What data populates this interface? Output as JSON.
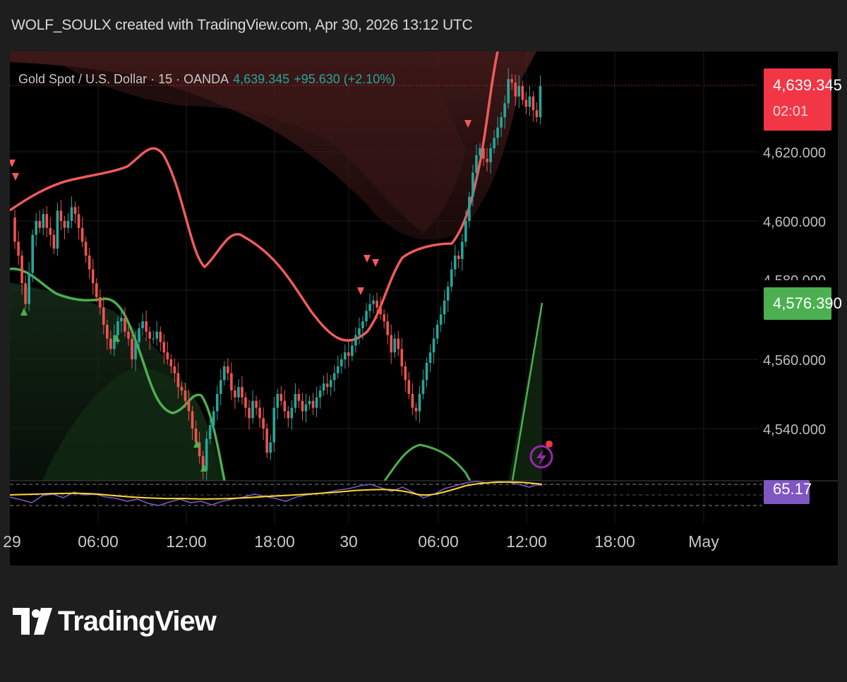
{
  "header": {
    "text": "WOLF_SOULX created with TradingView.com, Apr 30, 2026 13:12 UTC"
  },
  "legend": {
    "symbol": "Gold Spot / U.S. Dollar · 15 · OANDA",
    "price": "4,639.345",
    "change": "+95.630 (+2.10%)"
  },
  "price_tags": {
    "last_price": "4,639.345",
    "countdown": "02:01",
    "green_level": "4,576.390",
    "oscillator_value": "65.17"
  },
  "colors": {
    "up": "#26a69a",
    "down": "#ef5350",
    "band_upper": "#f05b5b",
    "band_lower": "#4caf50",
    "osc_line": "#7e57c2",
    "osc_signal": "#fdd835",
    "osc_tag": "#7e57c2",
    "last_price_tag": "#f23645",
    "green_tag": "#4caf50"
  },
  "icons": {
    "flash": "lightning-bolt-icon",
    "logo": "tradingview-logo-icon"
  },
  "brand": {
    "name": "TradingView"
  },
  "chart_data": {
    "type": "candlestick",
    "instrument": "Gold Spot / U.S. Dollar · 15 · OANDA",
    "y_ticks": [
      "4,620.000",
      "4,600.000",
      "4,580.000",
      "4,560.000",
      "4,540.000"
    ],
    "x_ticks": [
      "29",
      "06:00",
      "12:00",
      "18:00",
      "30",
      "06:00",
      "12:00",
      "18:00",
      "May"
    ],
    "ylim": [
      4525,
      4650
    ],
    "price_path": [
      [
        0,
        4601
      ],
      [
        1,
        4594
      ],
      [
        2,
        4590
      ],
      [
        3,
        4582
      ],
      [
        4,
        4576
      ],
      [
        5,
        4585
      ],
      [
        6,
        4596
      ],
      [
        7,
        4600
      ],
      [
        8,
        4598
      ],
      [
        9,
        4602
      ],
      [
        10,
        4598
      ],
      [
        11,
        4596
      ],
      [
        12,
        4592
      ],
      [
        13,
        4603
      ],
      [
        14,
        4600
      ],
      [
        15,
        4598
      ],
      [
        16,
        4600
      ],
      [
        17,
        4604
      ],
      [
        18,
        4602
      ],
      [
        19,
        4598
      ],
      [
        20,
        4594
      ],
      [
        21,
        4590
      ],
      [
        22,
        4586
      ],
      [
        23,
        4582
      ],
      [
        24,
        4578
      ],
      [
        25,
        4575
      ],
      [
        26,
        4570
      ],
      [
        27,
        4566
      ],
      [
        28,
        4563
      ],
      [
        29,
        4567
      ],
      [
        30,
        4571
      ],
      [
        31,
        4572
      ],
      [
        32,
        4568
      ],
      [
        33,
        4566
      ],
      [
        34,
        4560
      ],
      [
        35,
        4565
      ],
      [
        36,
        4569
      ],
      [
        37,
        4571
      ],
      [
        38,
        4568
      ],
      [
        39,
        4566
      ],
      [
        40,
        4566
      ],
      [
        41,
        4568
      ],
      [
        42,
        4565
      ],
      [
        43,
        4562
      ],
      [
        44,
        4560
      ],
      [
        45,
        4558
      ],
      [
        46,
        4556
      ],
      [
        47,
        4552
      ],
      [
        48,
        4551
      ],
      [
        49,
        4548
      ],
      [
        50,
        4545
      ],
      [
        51,
        4540
      ],
      [
        52,
        4536
      ],
      [
        53,
        4532
      ],
      [
        54,
        4528
      ],
      [
        55,
        4537
      ],
      [
        56,
        4541
      ],
      [
        57,
        4545
      ],
      [
        58,
        4550
      ],
      [
        59,
        4554
      ],
      [
        60,
        4558
      ],
      [
        61,
        4556
      ],
      [
        62,
        4551
      ],
      [
        63,
        4549
      ],
      [
        64,
        4552
      ],
      [
        65,
        4549
      ],
      [
        66,
        4546
      ],
      [
        67,
        4543
      ],
      [
        68,
        4548
      ],
      [
        69,
        4546
      ],
      [
        70,
        4543
      ],
      [
        71,
        4540
      ],
      [
        72,
        4533
      ],
      [
        73,
        4536
      ],
      [
        74,
        4546
      ],
      [
        75,
        4550
      ],
      [
        76,
        4548
      ],
      [
        77,
        4545
      ],
      [
        78,
        4543
      ],
      [
        79,
        4546
      ],
      [
        80,
        4550
      ],
      [
        81,
        4548
      ],
      [
        82,
        4545
      ],
      [
        83,
        4547
      ],
      [
        84,
        4548
      ],
      [
        85,
        4546
      ],
      [
        86,
        4549
      ],
      [
        87,
        4551
      ],
      [
        88,
        4553
      ],
      [
        89,
        4552
      ],
      [
        90,
        4554
      ],
      [
        91,
        4556
      ],
      [
        92,
        4558
      ],
      [
        93,
        4560
      ],
      [
        94,
        4562
      ],
      [
        95,
        4561
      ],
      [
        96,
        4564
      ],
      [
        97,
        4567
      ],
      [
        98,
        4569
      ],
      [
        99,
        4571
      ],
      [
        100,
        4574
      ],
      [
        101,
        4576
      ],
      [
        102,
        4577
      ],
      [
        103,
        4575
      ],
      [
        104,
        4573
      ],
      [
        105,
        4571
      ],
      [
        106,
        4567
      ],
      [
        107,
        4562
      ],
      [
        108,
        4566
      ],
      [
        109,
        4563
      ],
      [
        110,
        4558
      ],
      [
        111,
        4554
      ],
      [
        112,
        4550
      ],
      [
        113,
        4546
      ],
      [
        114,
        4545
      ],
      [
        115,
        4550
      ],
      [
        116,
        4554
      ],
      [
        117,
        4559
      ],
      [
        118,
        4562
      ],
      [
        119,
        4566
      ],
      [
        120,
        4570
      ],
      [
        121,
        4573
      ],
      [
        122,
        4577
      ],
      [
        123,
        4581
      ],
      [
        124,
        4586
      ],
      [
        125,
        4590
      ],
      [
        126,
        4589
      ],
      [
        127,
        4594
      ],
      [
        128,
        4600
      ],
      [
        129,
        4607
      ],
      [
        130,
        4614
      ],
      [
        131,
        4619
      ],
      [
        132,
        4621
      ],
      [
        133,
        4618
      ],
      [
        134,
        4617
      ],
      [
        135,
        4621
      ],
      [
        136,
        4624
      ],
      [
        137,
        4627
      ],
      [
        138,
        4630
      ],
      [
        139,
        4634
      ],
      [
        140,
        4641
      ],
      [
        141,
        4640
      ],
      [
        142,
        4636
      ],
      [
        143,
        4639
      ],
      [
        144,
        4635
      ],
      [
        145,
        4633
      ],
      [
        146,
        4636
      ],
      [
        147,
        4632
      ],
      [
        148,
        4630
      ],
      [
        149,
        4639
      ]
    ]
  }
}
